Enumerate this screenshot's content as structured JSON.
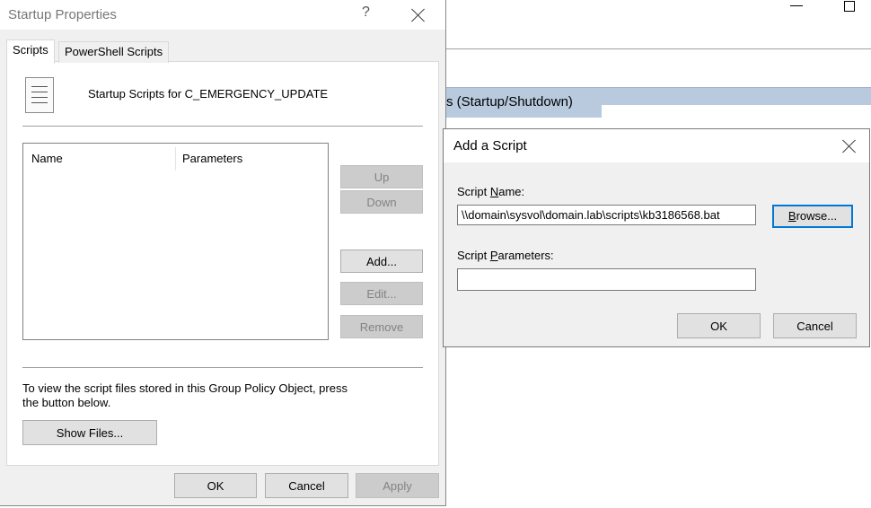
{
  "background": {
    "header_text": "s (Startup/Shutdown)"
  },
  "startup_dialog": {
    "title": "Startup Properties",
    "help_glyph": "?",
    "tabs": [
      {
        "label": "Scripts"
      },
      {
        "label": "PowerShell Scripts"
      }
    ],
    "heading": "Startup Scripts for C_EMERGENCY_UPDATE",
    "list_columns": [
      "Name",
      "Parameters"
    ],
    "buttons": {
      "up": "Up",
      "down": "Down",
      "add": "Add...",
      "edit": "Edit...",
      "remove": "Remove",
      "show_files": "Show Files...",
      "ok": "OK",
      "cancel": "Cancel",
      "apply": "Apply"
    },
    "info_text": "To view the script files stored in this Group Policy Object, press the button below."
  },
  "add_script_dialog": {
    "title": "Add a Script",
    "script_name_label_pre": "Script ",
    "script_name_label_key": "N",
    "script_name_label_post": "ame:",
    "script_name_value": "\\\\domain\\sysvol\\domain.lab\\scripts\\kb3186568.bat",
    "browse_key": "B",
    "browse_rest": "rowse...",
    "params_label_pre": "Script ",
    "params_label_key": "P",
    "params_label_post": "arameters:",
    "params_value": "",
    "ok": "OK",
    "cancel": "Cancel"
  }
}
